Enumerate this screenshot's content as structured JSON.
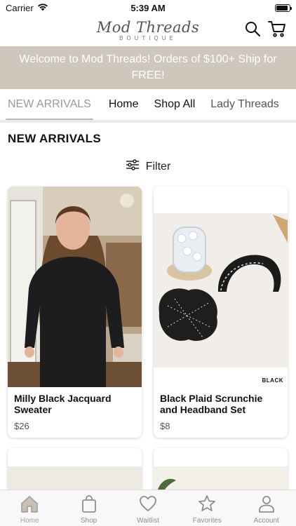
{
  "status_bar": {
    "carrier": "Carrier",
    "time": "5:39 AM",
    "battery_level": 0.9
  },
  "header": {
    "logo_text": "Mod Threads",
    "logo_subtext": "BOUTIQUE"
  },
  "announcement": "Welcome to Mod Threads! Orders of $100+ Ship for FREE!",
  "category_tabs": [
    {
      "label": "NEW ARRIVALS",
      "active": true
    },
    {
      "label": "Home",
      "active": false
    },
    {
      "label": "Shop All",
      "active": false
    },
    {
      "label": "Lady Threads",
      "active": false
    }
  ],
  "section_title": "NEW ARRIVALS",
  "filter_label": "Filter",
  "products": [
    {
      "name": "Milly Black Jacquard Sweater",
      "price": "$26"
    },
    {
      "name": "Black Plaid Scrunchie and Headband Set",
      "price": "$8",
      "image_tag": "BLACK"
    }
  ],
  "bottom_tabs": [
    {
      "label": "Home",
      "icon": "home-icon",
      "active": true
    },
    {
      "label": "Shop",
      "icon": "bag-icon",
      "active": false
    },
    {
      "label": "Waitlist",
      "icon": "heart-icon",
      "active": false
    },
    {
      "label": "Favorites",
      "icon": "star-icon",
      "active": false
    },
    {
      "label": "Account",
      "icon": "person-icon",
      "active": false
    }
  ],
  "colors": {
    "banner": "#cfc6bc",
    "active_tab": "#a9a39d",
    "text": "#111111"
  }
}
